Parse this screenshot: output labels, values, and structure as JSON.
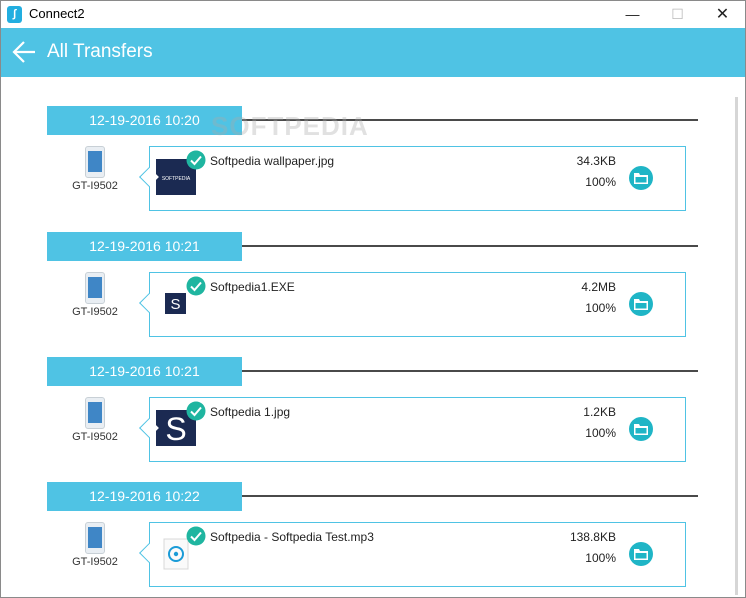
{
  "window": {
    "title": "Connect2",
    "app_icon": "connect2-logo-icon"
  },
  "header": {
    "title": "All Transfers",
    "back_icon": "back-arrow-icon"
  },
  "watermark": "SOFTPEDIA",
  "transfers": [
    {
      "date": "12-19-2016 10:20",
      "device": "GT-I9502",
      "file_name": "Softpedia wallpaper.jpg",
      "size": "34.3KB",
      "progress": "100%",
      "thumb_type": "wallpaper",
      "thumb_text": "SOFTPEDIA"
    },
    {
      "date": "12-19-2016 10:21",
      "device": "GT-I9502",
      "file_name": "Softpedia1.EXE",
      "size": "4.2MB",
      "progress": "100%",
      "thumb_type": "exe",
      "thumb_text": "S"
    },
    {
      "date": "12-19-2016 10:21",
      "device": "GT-I9502",
      "file_name": "Softpedia 1.jpg",
      "size": "1.2KB",
      "progress": "100%",
      "thumb_type": "jpg",
      "thumb_text": "S"
    },
    {
      "date": "12-19-2016 10:22",
      "device": "GT-I9502",
      "file_name": "Softpedia - Softpedia Test.mp3",
      "size": "138.8KB",
      "progress": "100%",
      "thumb_type": "audio",
      "thumb_text": ""
    }
  ],
  "colors": {
    "accent": "#4fc3e4",
    "check": "#1fb5a0",
    "folder": "#1fb5c6",
    "thumb_dark": "#1b2a52"
  }
}
